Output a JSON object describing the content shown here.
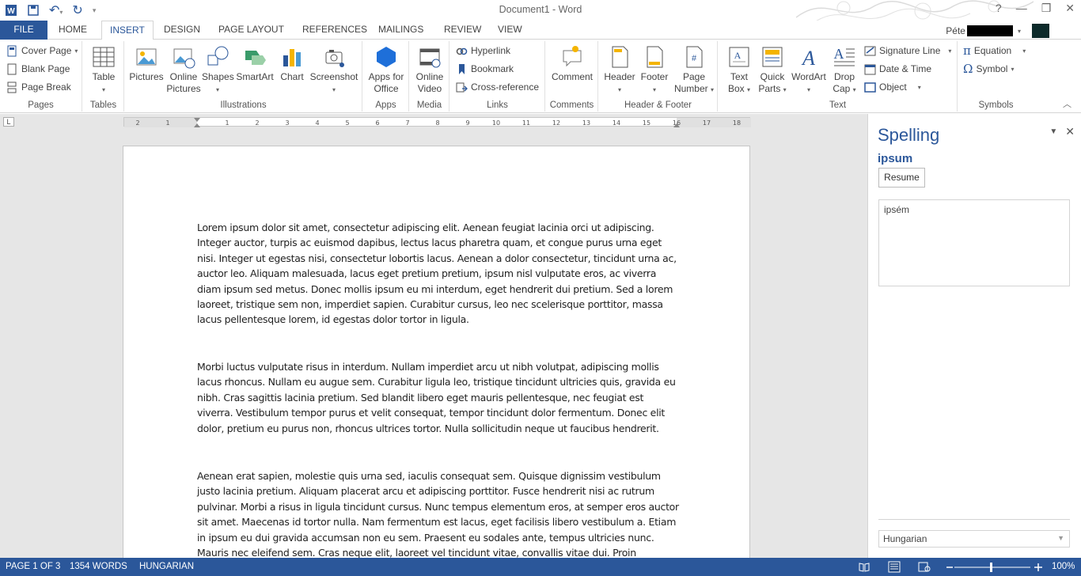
{
  "titlebar": {
    "title": "Document1 - Word",
    "qat": {
      "save_icon": "save-icon",
      "undo_icon": "undo-icon",
      "redo_icon": "redo-icon"
    },
    "window_controls": [
      "?",
      "—",
      "❒",
      "✕"
    ]
  },
  "tabs": {
    "items": [
      "FILE",
      "HOME",
      "INSERT",
      "DESIGN",
      "PAGE LAYOUT",
      "REFERENCES",
      "MAILINGS",
      "REVIEW",
      "VIEW"
    ],
    "active": "INSERT",
    "user": "Péte"
  },
  "ribbon": {
    "pages": {
      "label": "Pages",
      "cover_page": "Cover Page",
      "blank_page": "Blank Page",
      "page_break": "Page Break"
    },
    "tables": {
      "label": "Tables",
      "table": "Table"
    },
    "illustrations": {
      "label": "Illustrations",
      "pictures": "Pictures",
      "online_pictures_1": "Online",
      "online_pictures_2": "Pictures",
      "shapes": "Shapes",
      "smartart": "SmartArt",
      "chart": "Chart",
      "screenshot": "Screenshot"
    },
    "apps": {
      "label": "Apps",
      "apps_1": "Apps for",
      "apps_2": "Office"
    },
    "media": {
      "label": "Media",
      "video_1": "Online",
      "video_2": "Video"
    },
    "links": {
      "label": "Links",
      "hyperlink": "Hyperlink",
      "bookmark": "Bookmark",
      "cross_reference": "Cross-reference"
    },
    "comments": {
      "label": "Comments",
      "comment": "Comment"
    },
    "header_footer": {
      "label": "Header & Footer",
      "header": "Header",
      "footer": "Footer",
      "page_number_1": "Page",
      "page_number_2": "Number"
    },
    "text": {
      "label": "Text",
      "text_box_1": "Text",
      "text_box_2": "Box",
      "quick_parts_1": "Quick",
      "quick_parts_2": "Parts",
      "wordart": "WordArt",
      "drop_cap_1": "Drop",
      "drop_cap_2": "Cap",
      "signature_line": "Signature Line",
      "date_time": "Date & Time",
      "object": "Object"
    },
    "symbols": {
      "label": "Symbols",
      "equation": "Equation",
      "symbol": "Symbol"
    }
  },
  "document": {
    "paragraphs": [
      "Lorem ipsum dolor sit amet, consectetur adipiscing elit. Aenean feugiat lacinia orci ut adipiscing. Integer auctor, turpis ac euismod dapibus, lectus lacus pharetra quam, et congue purus urna eget nisi. Integer ut egestas nisi, consectetur lobortis lacus. Aenean a dolor consectetur, tincidunt urna ac, auctor leo. Aliquam malesuada, lacus eget pretium pretium, ipsum nisl vulputate eros, ac viverra diam ipsum sed metus. Donec mollis ipsum eu mi interdum, eget hendrerit dui pretium. Sed a lorem laoreet, tristique sem non, imperdiet sapien. Curabitur cursus, leo nec scelerisque porttitor, massa lacus pellentesque lorem, id egestas dolor tortor in ligula.",
      "Morbi luctus vulputate risus in interdum. Nullam imperdiet arcu ut nibh volutpat, adipiscing mollis lacus rhoncus. Nullam eu augue sem. Curabitur ligula leo, tristique tincidunt ultricies quis, gravida eu nibh. Cras sagittis lacinia pretium. Sed blandit libero eget mauris pellentesque, nec feugiat est viverra. Vestibulum tempor purus et velit consequat, tempor tincidunt dolor fermentum. Donec elit dolor, pretium eu purus non, rhoncus ultrices tortor. Nulla sollicitudin neque ut faucibus hendrerit.",
      "Aenean erat sapien, molestie quis urna sed, iaculis consequat sem. Quisque dignissim vestibulum justo lacinia pretium. Aliquam placerat arcu et adipiscing porttitor. Fusce hendrerit nisi ac rutrum pulvinar. Morbi a risus in ligula tincidunt cursus. Nunc tempus elementum eros, at semper eros auctor sit amet. Maecenas id tortor nulla. Nam fermentum est lacus, eget facilisis libero vestibulum a. Etiam in ipsum eu dui gravida accumsan non eu sem. Praesent eu sodales ante, tempus ultricies nunc. Mauris nec eleifend sem. Cras neque elit, laoreet vel tincidunt vitae, convallis vitae dui. Proin"
    ]
  },
  "spelling_pane": {
    "title": "Spelling",
    "word": "ipsum",
    "resume": "Resume",
    "suggestions": [
      "ipsém"
    ],
    "language": "Hungarian"
  },
  "status": {
    "page": "PAGE 1 OF 3",
    "words": "1354 WORDS",
    "language": "HUNGARIAN",
    "zoom": "100%"
  },
  "colors": {
    "accent": "#2b579a"
  }
}
